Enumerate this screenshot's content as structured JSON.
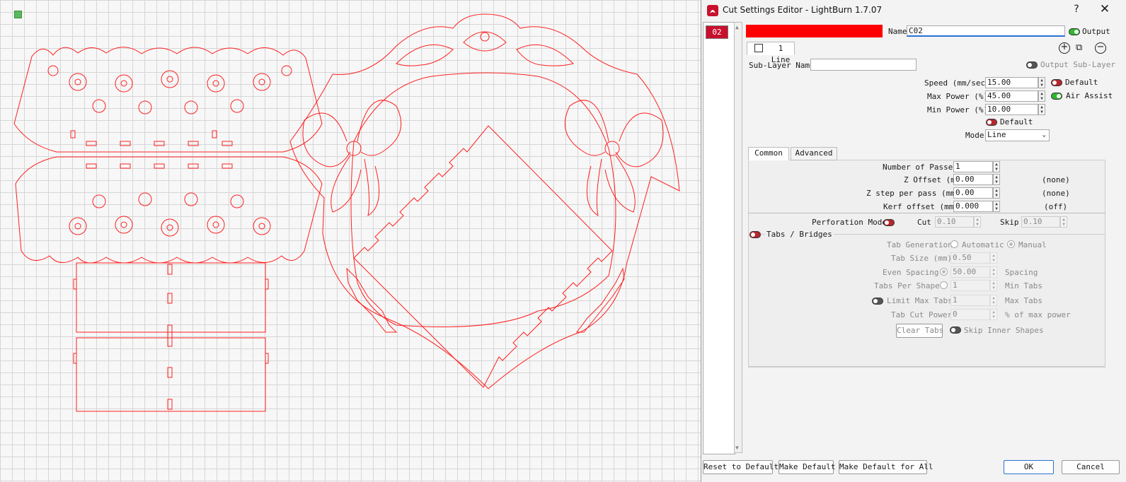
{
  "dialog": {
    "title": "Cut Settings Editor - LightBurn 1.7.07",
    "help_glyph": "?",
    "close_glyph": "✕"
  },
  "layer": {
    "chip_label": "02",
    "color": "#ff0000",
    "name_label": "Name",
    "name_value": "C02",
    "output_label": "Output",
    "output_on": true
  },
  "sublayer": {
    "tab_label": "1 Line",
    "name_label": "Sub-Layer Name",
    "name_value": "",
    "output_sublayer_label": "Output Sub-Layer"
  },
  "settings": {
    "speed_label": "Speed (mm/sec)",
    "speed_value": "15.00",
    "default_label": "Default",
    "max_power_label": "Max Power (%)",
    "max_power_value": "45.00",
    "air_assist_label": "Air Assist",
    "min_power_label": "Min Power (%)",
    "min_power_value": "10.00",
    "min_default_label": "Default",
    "mode_label": "Mode",
    "mode_value": "Line"
  },
  "tabs": {
    "common": "Common",
    "advanced": "Advanced"
  },
  "common": {
    "passes_label": "Number of Passes",
    "passes_value": "1",
    "z_offset_label": "Z Offset (mm)",
    "z_offset_value": "0.00",
    "z_offset_note": "(none)",
    "z_step_label": "Z step per pass (mm)",
    "z_step_value": "0.00",
    "z_step_note": "(none)",
    "kerf_label": "Kerf offset (mm)",
    "kerf_value": "0.000",
    "kerf_note": "(off)",
    "perforation_label": "Perforation Mode",
    "cut_label": "Cut",
    "cut_value": "0.10",
    "skip_label": "Skip",
    "skip_value": "0.10"
  },
  "bridges": {
    "section_label": "Tabs / Bridges",
    "generation_label": "Tab Generation",
    "automatic_label": "Automatic",
    "manual_label": "Manual",
    "tab_size_label": "Tab Size (mm)",
    "tab_size_value": "0.50",
    "even_spacing_label": "Even Spacing",
    "even_spacing_value": "50.00",
    "spacing_label": "Spacing",
    "tabs_per_shape_label": "Tabs Per Shape",
    "tabs_per_shape_value": "1",
    "min_tabs_label": "Min Tabs",
    "limit_max_label": "Limit Max Tabs",
    "limit_max_value": "1",
    "max_tabs_label": "Max Tabs",
    "tab_cut_power_label": "Tab Cut Power",
    "tab_cut_power_value": "0",
    "pct_max_power_label": "% of max power",
    "clear_tabs_label": "Clear Tabs",
    "skip_inner_label": "Skip Inner Shapes"
  },
  "footer": {
    "reset_label": "Reset to Default",
    "make_default_label": "Make Default",
    "make_default_all_label": "Make Default for All",
    "ok_label": "OK",
    "cancel_label": "Cancel"
  },
  "colors": {
    "cut_red": "#ff2020",
    "layer_chip": "#c8102e",
    "toggle_on": "#2fb72f",
    "toggle_off": "#b5262e"
  }
}
